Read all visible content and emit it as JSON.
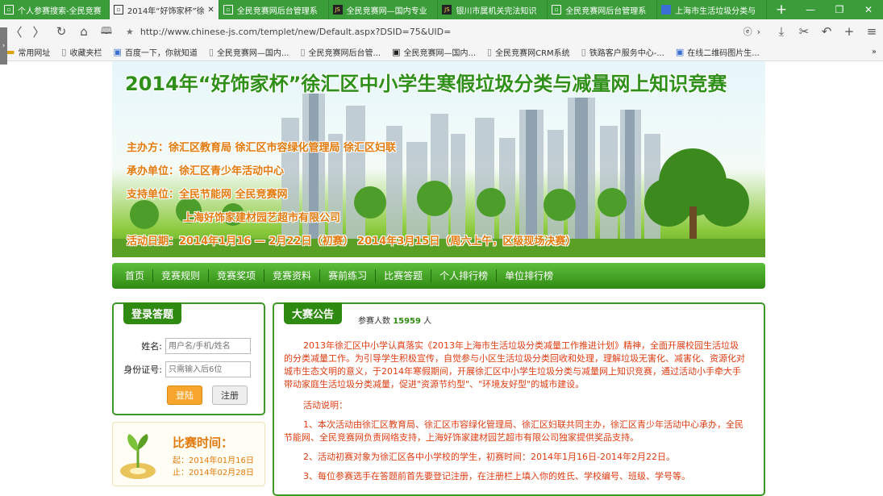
{
  "browser": {
    "tabs": [
      {
        "label": "个人参赛搜索-全民竞赛",
        "icon": "page-icon",
        "active": false
      },
      {
        "label": "2014年“好饰家杯”徐",
        "icon": "page-icon",
        "active": true
      },
      {
        "label": "全民竞赛网后台管理系",
        "icon": "page-icon",
        "active": false
      },
      {
        "label": "全民竞赛网—国内专业",
        "icon": "js-logo-icon",
        "active": false
      },
      {
        "label": "银川市属机关完法知识",
        "icon": "js-logo-icon",
        "active": false
      },
      {
        "label": "全民竞赛网后台管理系",
        "icon": "page-icon",
        "active": false
      },
      {
        "label": "上海市生活垃圾分类与",
        "icon": "site-icon",
        "active": false
      }
    ],
    "new_tab": "+",
    "controls": {
      "minimize": "—",
      "restore": "❐",
      "close": "✕"
    },
    "nav": {
      "back": "〈",
      "forward": "〉",
      "reload": "↻",
      "home": "⌂",
      "reader": "🕮"
    },
    "url": "http://www.chinese-js.com/templet/new/Default.aspx?DSID=75&UID=",
    "bookmarks": [
      {
        "label": "常用网址",
        "icon": "folder-icon"
      },
      {
        "label": "收藏夹栏",
        "icon": "page-icon"
      },
      {
        "label": "百度一下，你就知道",
        "icon": "site-icon"
      },
      {
        "label": "全民竞赛网—国内...",
        "icon": "page-icon"
      },
      {
        "label": "全民竞赛网后台管...",
        "icon": "page-icon"
      },
      {
        "label": "全民竞赛网—国内...",
        "icon": "js-logo-icon"
      },
      {
        "label": "全民竞赛网CRM系统",
        "icon": "page-icon"
      },
      {
        "label": "铁路客户服务中心-...",
        "icon": "page-icon"
      },
      {
        "label": "在线二维码图片生...",
        "icon": "site-icon"
      }
    ],
    "bookmarks_more": "»"
  },
  "banner": {
    "title": "2014年“好饰家杯”徐汇区中小学生寒假垃圾分类与减量网上知识竞赛",
    "organizer": "主办方：徐汇区教育局    徐汇区市容绿化管理局      徐汇区妇联",
    "undertaker": "承办单位：徐汇区青少年活动中心",
    "supporter": "支持单位：全民节能网      全民竞赛网",
    "sponsor": "上海好饰家建材园艺超市有限公司",
    "dates": "活动日期：2014年1月16 — 2月22日（初赛）    2014年3月15日（周六上午，区级现场决赛）"
  },
  "nav": [
    "首页",
    "竞赛规则",
    "竞赛奖项",
    "竞赛资料",
    "赛前练习",
    "比赛答题",
    "个人排行榜",
    "单位排行榜"
  ],
  "login": {
    "title": "登录答题",
    "name_label": "姓名:",
    "name_placeholder": "用户名/手机/姓名",
    "id_label": "身份证号:",
    "id_placeholder": "只需输入后6位",
    "login_button": "登陆",
    "register_button": "注册"
  },
  "schedule": {
    "title": "比赛时间：",
    "start": "起：2014年01月16日",
    "end": "止：2014年02月28日"
  },
  "announcement": {
    "title": "大赛公告",
    "count_label": "参赛人数",
    "count_value": "15959",
    "count_unit": "人",
    "intro": "2013年徐汇区中小学认真落实《2013年上海市生活垃圾分类减量工作推进计划》精神，全面开展校园生活垃圾的分类减量工作。为引导学生积极宣传，自觉参与小区生活垃圾分类回收和处理，理解垃圾无害化、减害化、资源化对城市生态文明的意义，于2014年寒假期间，开展徐汇区中小学生垃圾分类与减量网上知识竞赛，通过活动小手牵大手带动家庭生活垃圾分类减量，促进\"资源节约型\"、\"环境友好型\"的城市建设。",
    "heading": "活动说明：",
    "item1": "1、本次活动由徐汇区教育局、徐汇区市容绿化管理局、徐汇区妇联共同主办，徐汇区青少年活动中心承办，全民节能网、全民竞赛网负责网络支持，上海好饰家建材园艺超市有限公司独家提供奖品支持。",
    "item2": "2、活动初赛对象为徐汇区各中小学校的学生，初赛时间：2014年1月16日-2014年2月22日。",
    "item3": "3、每位参赛选手在答题前首先要登记注册，在注册栏上填入你的姓氏、学校编号、班级、学号等。"
  }
}
